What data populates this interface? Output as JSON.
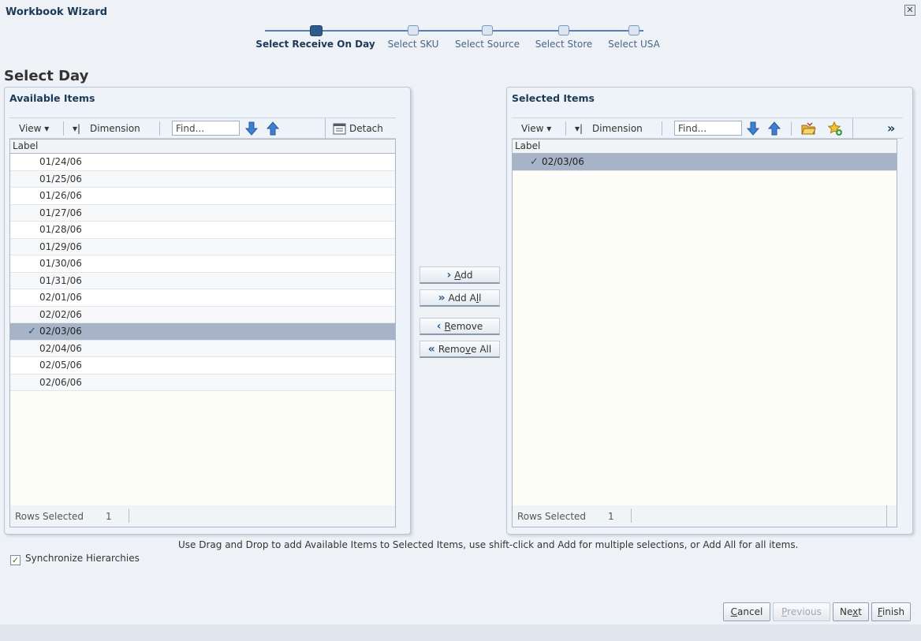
{
  "window": {
    "title": "Workbook Wizard",
    "close": "✕"
  },
  "train": {
    "steps": [
      "Select Receive On Day",
      "Select SKU",
      "Select Source",
      "Select Store",
      "Select USA"
    ],
    "active_index": 0
  },
  "page": {
    "heading": "Select Day"
  },
  "available": {
    "title": "Available Items",
    "toolbar": {
      "view": "View ▾",
      "dimension": "Dimension",
      "find_placeholder": "Find...",
      "detach": "Detach"
    },
    "column": "Label",
    "rows": [
      "01/24/06",
      "01/25/06",
      "01/26/06",
      "01/27/06",
      "01/28/06",
      "01/29/06",
      "01/30/06",
      "01/31/06",
      "02/01/06",
      "02/02/06",
      "02/03/06",
      "02/04/06",
      "02/05/06",
      "02/06/06"
    ],
    "selected_row": "02/03/06",
    "footer": {
      "label": "Rows Selected",
      "count": "1"
    }
  },
  "selected": {
    "title": "Selected Items",
    "toolbar": {
      "view": "View ▾",
      "dimension": "Dimension",
      "find_placeholder": "Find...",
      "more": "»"
    },
    "column": "Label",
    "rows": [
      "02/03/06"
    ],
    "footer": {
      "label": "Rows Selected",
      "count": "1"
    }
  },
  "shuttle": {
    "add": {
      "icon": "›",
      "underline": "A",
      "rest": "dd"
    },
    "add_all": {
      "icon": "»",
      "before": "Add A",
      "underline": "l",
      "after": "l"
    },
    "remove": {
      "icon": "‹",
      "underline": "R",
      "rest": "emove"
    },
    "remove_all": {
      "icon": "«",
      "before": "Remo",
      "underline": "v",
      "after": "e All"
    }
  },
  "instruction": "Use Drag and Drop to add Available Items to Selected Items, use shift-click and Add for multiple selections, or Add All for all items.",
  "sync": {
    "label": "Synchronize Hierarchies",
    "checked": true
  },
  "buttons": {
    "cancel": {
      "u": "C",
      "rest": "ancel"
    },
    "previous": {
      "u": "P",
      "rest": "revious",
      "disabled": true
    },
    "next": {
      "first": "Ne",
      "u": "x",
      "rest": "t"
    },
    "finish": {
      "u": "F",
      "rest": "inish"
    }
  },
  "colors": {
    "accent": "#2e5c8a",
    "selected_row": "#a7b4c8",
    "title": "#1c3a57"
  }
}
